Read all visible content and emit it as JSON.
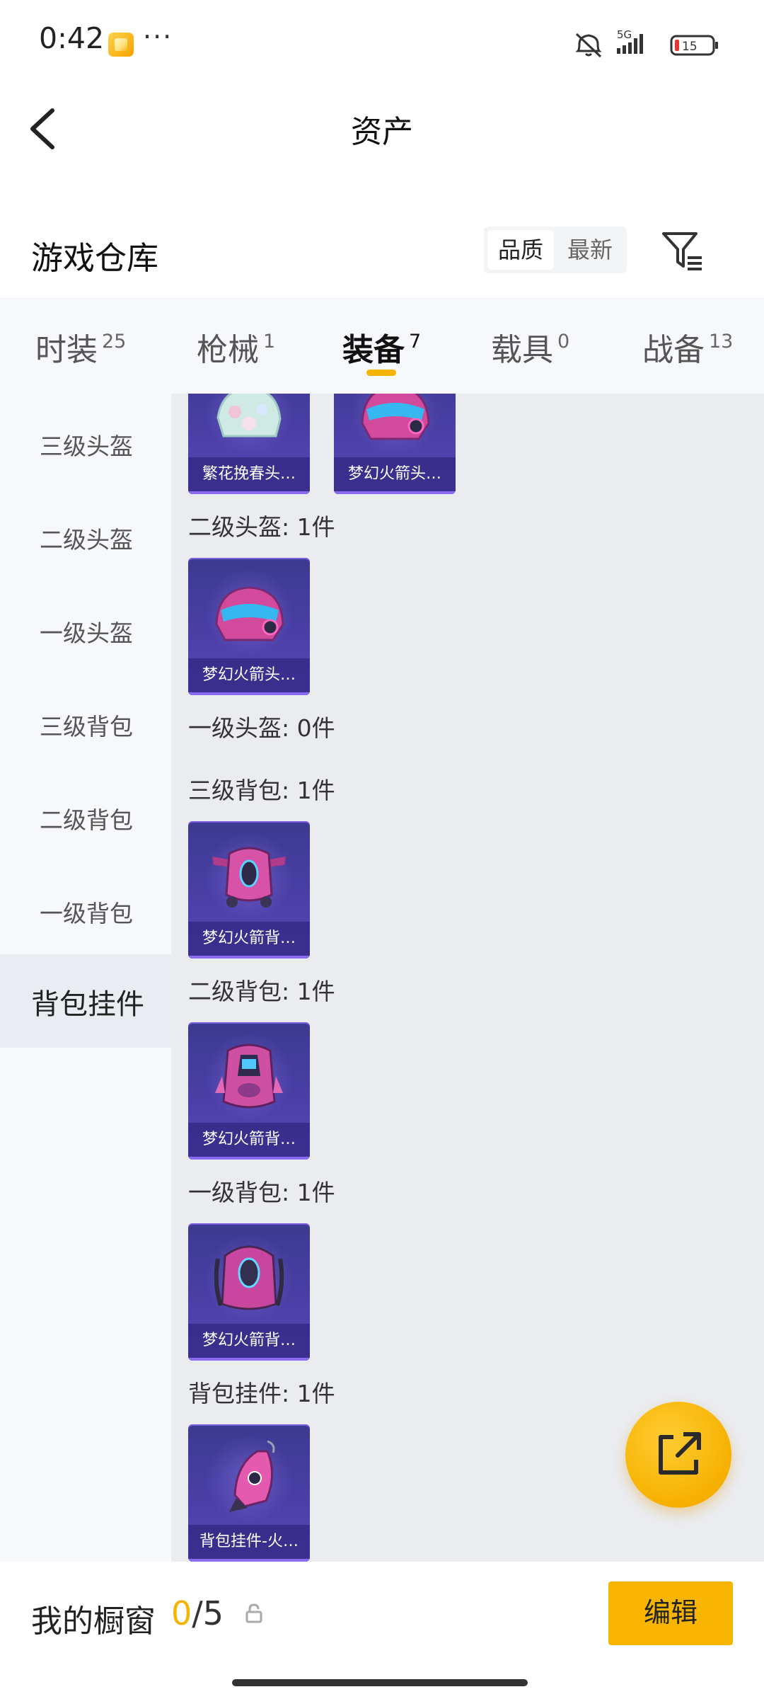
{
  "status_bar": {
    "time": "0:42",
    "more": "···",
    "network": "5G",
    "battery": "15"
  },
  "header": {
    "title": "资产"
  },
  "warehouse": {
    "title": "游戏仓库",
    "sort_options": [
      "品质",
      "最新"
    ],
    "selected_sort": "品质"
  },
  "tabs": [
    {
      "label": "时装",
      "count": "25"
    },
    {
      "label": "枪械",
      "count": "1"
    },
    {
      "label": "装备",
      "count": "7"
    },
    {
      "label": "载具",
      "count": "0"
    },
    {
      "label": "战备",
      "count": "13"
    }
  ],
  "active_tab": "装备",
  "sidebar": {
    "items": [
      "三级头盔",
      "二级头盔",
      "一级头盔",
      "三级背包",
      "二级背包",
      "一级背包",
      "背包挂件"
    ],
    "selected": "背包挂件"
  },
  "sections": [
    {
      "label": "",
      "items": [
        "繁花挽春头…",
        "梦幻火箭头…"
      ]
    },
    {
      "label": "二级头盔: 1件",
      "items": [
        "梦幻火箭头…"
      ]
    },
    {
      "label": "一级头盔: 0件",
      "items": []
    },
    {
      "label": "三级背包: 1件",
      "items": [
        "梦幻火箭背…"
      ]
    },
    {
      "label": "二级背包: 1件",
      "items": [
        "梦幻火箭背…"
      ]
    },
    {
      "label": "一级背包: 1件",
      "items": [
        "梦幻火箭背…"
      ]
    },
    {
      "label": "背包挂件: 1件",
      "items": [
        "背包挂件-火…"
      ]
    }
  ],
  "bottom_bar": {
    "showcase_label": "我的橱窗",
    "showcase_current": "0",
    "showcase_total": "/5",
    "edit_label": "编辑"
  },
  "icons": {
    "back": "chevron-left-icon",
    "filter": "filter-icon",
    "share": "share-icon",
    "lock": "lock-icon"
  },
  "colors": {
    "accent": "#f4b400",
    "card_bg": "#4b3fa6",
    "content_bg": "#eaecf0"
  }
}
